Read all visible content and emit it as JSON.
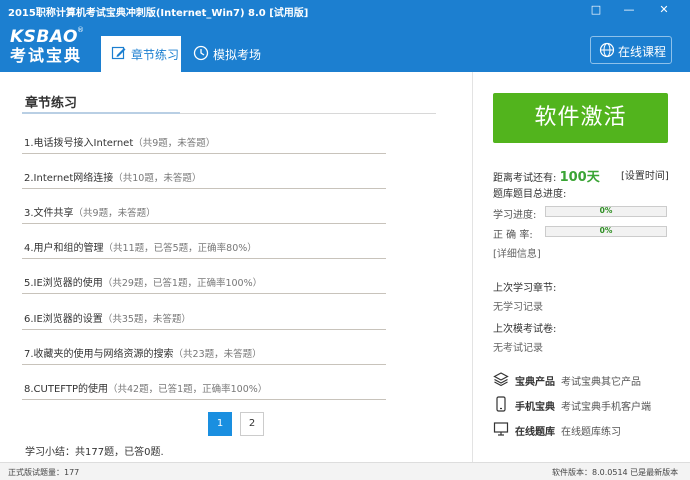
{
  "window": {
    "title": "2015职称计算机考试宝典冲刺版(Internet_Win7) 8.0 [试用版]",
    "buttons": [
      "□",
      "—",
      "✕"
    ]
  },
  "logo": {
    "en": "KSBAO",
    "cn": "考试宝典",
    "reg": "®"
  },
  "tabs": [
    {
      "label": "章节练习",
      "icon": "edit-icon",
      "active": true
    },
    {
      "label": "模拟考场",
      "icon": "clock-icon",
      "active": false
    }
  ],
  "online_course": {
    "label": "在线课程",
    "icon": "globe-icon"
  },
  "main": {
    "title": "章节练习",
    "chapters": [
      {
        "name": "1.电话拨号接入Internet",
        "stat": "（共9题，未答题）"
      },
      {
        "name": "2.Internet网络连接",
        "stat": "（共10题，未答题）"
      },
      {
        "name": "3.文件共享",
        "stat": "（共9题，未答题）"
      },
      {
        "name": "4.用户和组的管理",
        "stat": "（共11题，已答5题，正确率80%）"
      },
      {
        "name": "5.IE浏览器的使用",
        "stat": "（共29题，已答1题，正确率100%）"
      },
      {
        "name": "6.IE浏览器的设置",
        "stat": "（共35题，未答题）"
      },
      {
        "name": "7.收藏夹的使用与网络资源的搜索",
        "stat": "（共23题，未答题）"
      },
      {
        "name": "8.CUTEFTP的使用",
        "stat": "（共42题，已答1题，正确率100%）"
      }
    ],
    "pages": [
      "1",
      "2"
    ],
    "summary": "学习小结：共177题，已答0题."
  },
  "sidebar": {
    "activate_label": "软件激活",
    "countdown_prefix": "距离考试还有:",
    "countdown_value": "100天",
    "set_time_label": "[设置时间]",
    "progress_heading": "题库题目总进度:",
    "progress": [
      {
        "label": "学习进度:",
        "value": 0,
        "text": "0%"
      },
      {
        "label": "正 确 率:",
        "value": 0,
        "text": "0%"
      }
    ],
    "details_label": "[详细信息]",
    "last_study_label": "上次学习章节:",
    "last_study_value": "无学习记录",
    "last_exam_label": "上次模考试卷:",
    "last_exam_value": "无考试记录",
    "links": [
      {
        "label": "宝典产品",
        "desc": "考试宝典其它产品",
        "icon": "layers-icon"
      },
      {
        "label": "手机宝典",
        "desc": "考试宝典手机客户端",
        "icon": "phone-icon"
      },
      {
        "label": "在线题库",
        "desc": "在线题库练习",
        "icon": "monitor-icon"
      }
    ]
  },
  "status": {
    "left": "正式版试题量：177",
    "right": "软件版本：8.0.0514   已是最新版本"
  },
  "colors": {
    "accent": "#1c7fd0",
    "activate": "#52b41d",
    "progress": "#7fd36b"
  }
}
